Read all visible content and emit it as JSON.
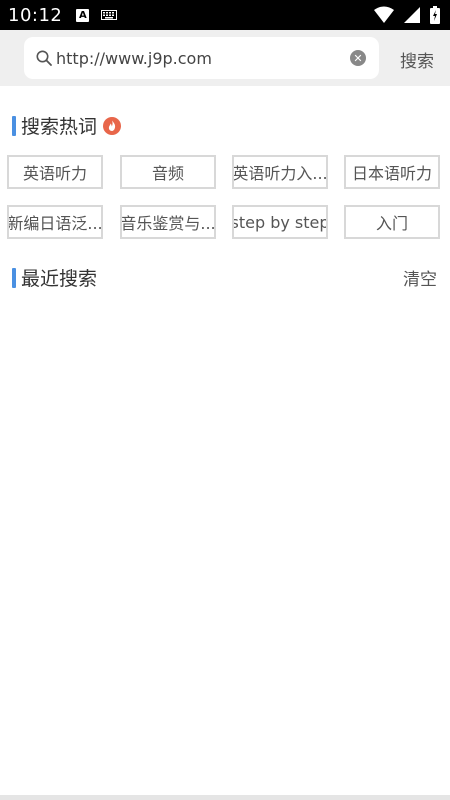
{
  "status_bar": {
    "time": "10:12",
    "a_icon_letter": "A"
  },
  "search": {
    "value": "http://www.j9p.com",
    "button_label": "搜索"
  },
  "hot_section": {
    "title": "搜索热词",
    "tags": [
      "英语听力",
      "音频",
      "英语听力入...",
      "日本语听力",
      "新编日语泛...",
      "音乐鉴赏与...",
      "step by step",
      "入门"
    ]
  },
  "recent_section": {
    "title": "最近搜索",
    "clear_label": "清空"
  },
  "colors": {
    "accent": "#4a90e2",
    "fire": "#e8664a"
  }
}
